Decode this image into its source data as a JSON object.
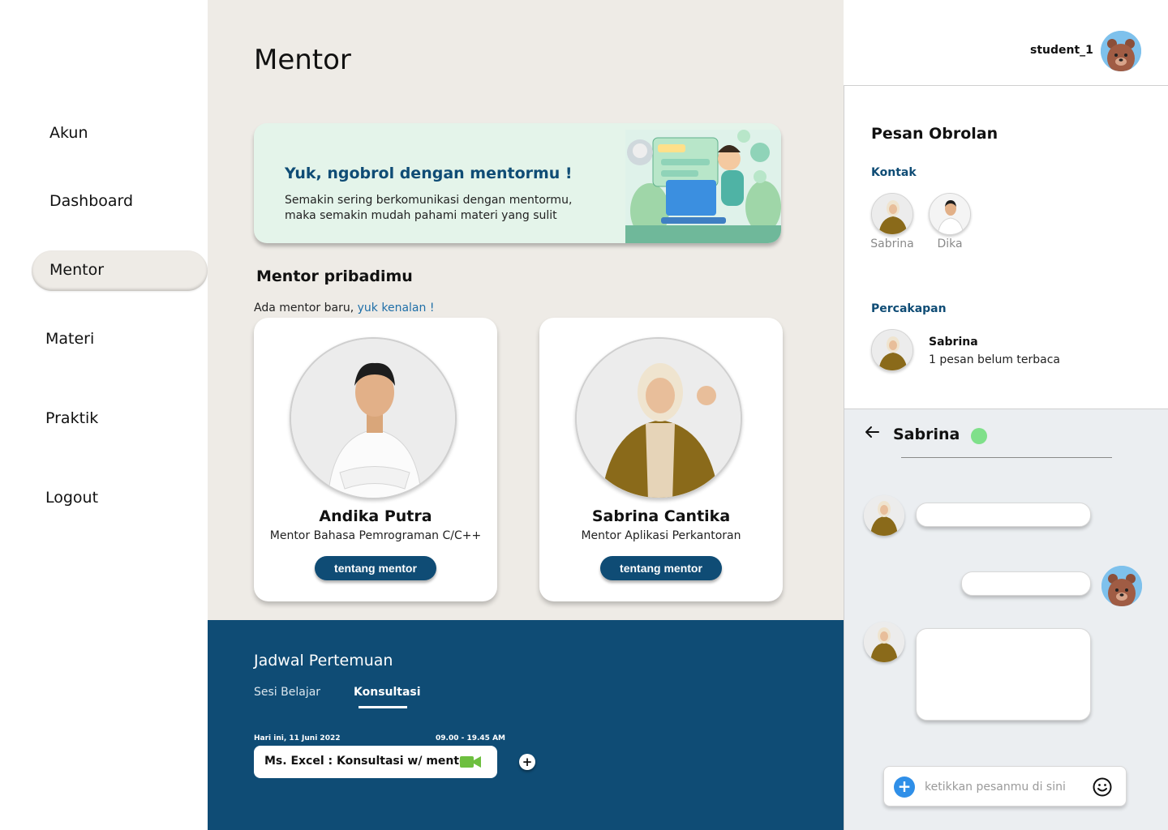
{
  "sidebar": {
    "items": [
      {
        "label": "Akun"
      },
      {
        "label": "Dashboard"
      },
      {
        "label": "Mentor",
        "active": true
      },
      {
        "label": "Materi"
      },
      {
        "label": "Praktik"
      },
      {
        "label": "Logout"
      }
    ]
  },
  "main": {
    "title": "Mentor",
    "banner": {
      "title": "Yuk, ngobrol dengan mentormu !",
      "line1": "Semakin sering berkomunikasi dengan mentormu,",
      "line2": "maka semakin mudah pahami materi yang sulit"
    },
    "section_title": "Mentor pribadimu",
    "section_sub": "Ada mentor baru, ",
    "section_link": "yuk kenalan !",
    "mentors": [
      {
        "name": "Andika Putra",
        "role": "Mentor Bahasa Pemrograman C/C++",
        "button": "tentang mentor"
      },
      {
        "name": "Sabrina Cantika",
        "role": "Mentor Aplikasi Perkantoran",
        "button": "tentang mentor"
      }
    ]
  },
  "schedule": {
    "title": "Jadwal Pertemuan",
    "tabs": [
      {
        "label": "Sesi Belajar",
        "active": false
      },
      {
        "label": "Konsultasi",
        "active": true
      }
    ],
    "date": "Hari ini, 11 Juni 2022",
    "time": "09.00 - 19.45 AM",
    "item": "Ms. Excel : Konsultasi w/ mentor",
    "add_label": "+"
  },
  "user": {
    "username": "student_1"
  },
  "chat_panel": {
    "title": "Pesan Obrolan",
    "contacts_label": "Kontak",
    "contacts": [
      {
        "name": "Sabrina"
      },
      {
        "name": "Dika"
      }
    ],
    "conversations_label": "Percakapan",
    "conversation": {
      "name": "Sabrina",
      "preview": "1 pesan belum terbaca"
    }
  },
  "chat_window": {
    "contact_name": "Sabrina",
    "status_color": "#7fe08a",
    "input_placeholder": "ketikkan pesanmu di sini"
  },
  "colors": {
    "primary": "#0f4c75",
    "main_bg": "#eeebe6",
    "banner_bg": "#e4f4ea",
    "chat_bg": "#ebeef1",
    "link": "#1f6fa8"
  },
  "icons": [
    "back-arrow-icon",
    "video-camera-icon",
    "plus-icon",
    "emoji-icon"
  ]
}
